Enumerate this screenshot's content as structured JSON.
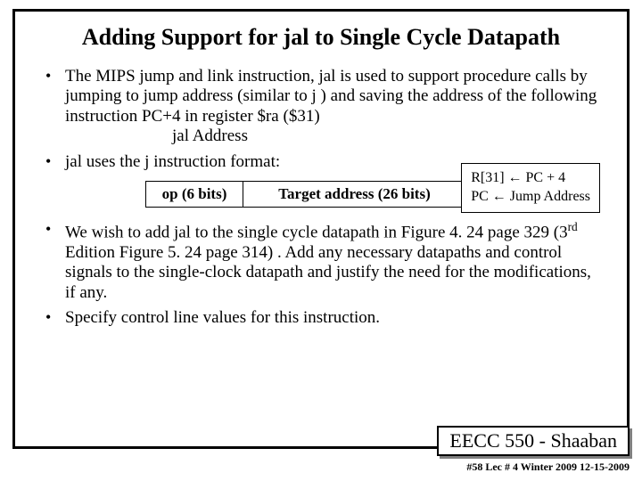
{
  "title": "Adding Support for jal to Single Cycle Datapath",
  "bullet1": "The MIPS jump and link instruction,  jal  is used to support procedure calls by jumping to jump address  (similar to j ) and saving the address of the following instruction PC+4  in register $ra  ($31)",
  "jal_line": "jal   Address",
  "bullet2": "jal  uses the  j  instruction format:",
  "side_line1a": "R[31]  ",
  "side_arrow": "←",
  "side_line1b": "   PC + 4",
  "side_line2a": "PC  ",
  "side_line2b": "   Jump Address",
  "fmt_op": "op (6 bits)",
  "fmt_target": "Target address (26 bits)",
  "bullet3a": "We wish to add  jal  to the single cycle datapath in Figure 4. 24 page 329 (3",
  "bullet3_sup": "rd",
  "bullet3b": " Edition Figure 5. 24 page 314) .  Add any necessary datapaths and control signals to the single-clock datapath and justify the need for the modifications, if any.",
  "bullet4": "Specify control line values for this instruction.",
  "footer_course": "EECC 550 - Shaaban",
  "footer_meta": "#58   Lec # 4   Winter 2009   12-15-2009"
}
